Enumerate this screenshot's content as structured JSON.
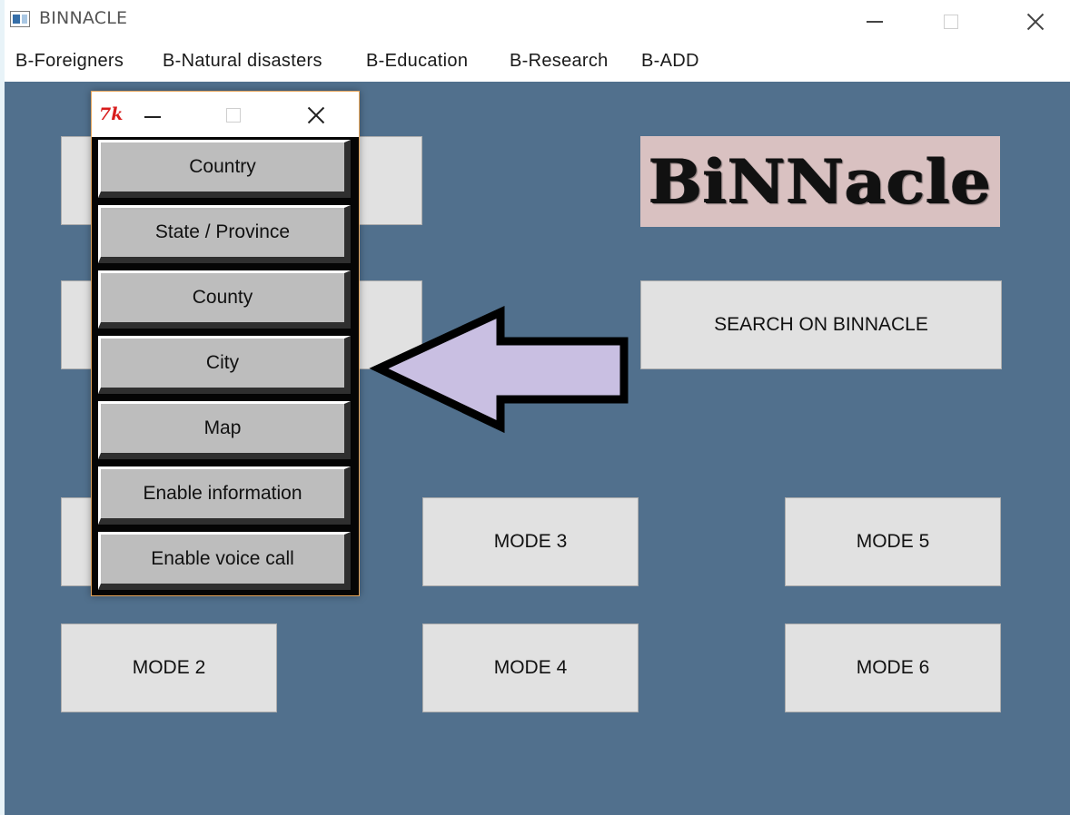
{
  "window": {
    "title": "BINNACLE",
    "menu": [
      "B-Foreigners",
      "B-Natural disasters",
      "B-Education",
      "B-Research",
      "B-ADD"
    ]
  },
  "logo": {
    "text": "BiNNacle",
    "background": "#d9c1c1"
  },
  "main": {
    "search_label": "SEARCH ON BINNACLE",
    "modes": [
      "MODE 2",
      "MODE 3",
      "MODE 4",
      "MODE 5",
      "MODE 6"
    ]
  },
  "popup": {
    "icon_text": "7k",
    "buttons": [
      "Country",
      "State / Province",
      "County",
      "City",
      "Map",
      "Enable information",
      "Enable voice call"
    ]
  },
  "colors": {
    "window_bg": "#51708d",
    "button_bg": "#e1e1e1",
    "tk_button_bg": "#bdbdbd",
    "arrow_fill": "#c9bfe2",
    "popup_border": "#e5a55b"
  },
  "icons": [
    "app-icon",
    "minimize-icon",
    "maximize-icon",
    "close-icon",
    "tk-icon",
    "arrow-left-icon"
  ]
}
